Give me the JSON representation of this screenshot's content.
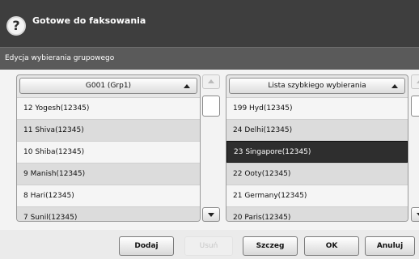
{
  "window": {
    "title": "Gotowe do faksowania",
    "subtitle": "Edycja wybierania grupowego",
    "help_icon": "question-mark-icon"
  },
  "left_panel": {
    "header": "G001 (Grp1)",
    "items": [
      {
        "label": "12  Yogesh(12345)"
      },
      {
        "label": "11  Shiva(12345)"
      },
      {
        "label": "10  Shiba(12345)"
      },
      {
        "label": "9  Manish(12345)"
      },
      {
        "label": "8  Hari(12345)"
      },
      {
        "label": "7  Sunil(12345)"
      }
    ]
  },
  "right_panel": {
    "header": "Lista szybkiego wybierania",
    "selected_index": 2,
    "items": [
      {
        "label": "199  Hyd(12345)"
      },
      {
        "label": "24  Delhi(12345)"
      },
      {
        "label": "23  Singapore(12345)"
      },
      {
        "label": "22  Ooty(12345)"
      },
      {
        "label": "21  Germany(12345)"
      },
      {
        "label": "20  Paris(12345)"
      }
    ]
  },
  "buttons": {
    "add": "Dodaj",
    "remove": "Usuń",
    "details": "Szczeg",
    "ok": "OK",
    "cancel": "Anuluj"
  },
  "colors": {
    "titlebar": "#3e3e3e",
    "selected_row": "#2e2e2e"
  }
}
